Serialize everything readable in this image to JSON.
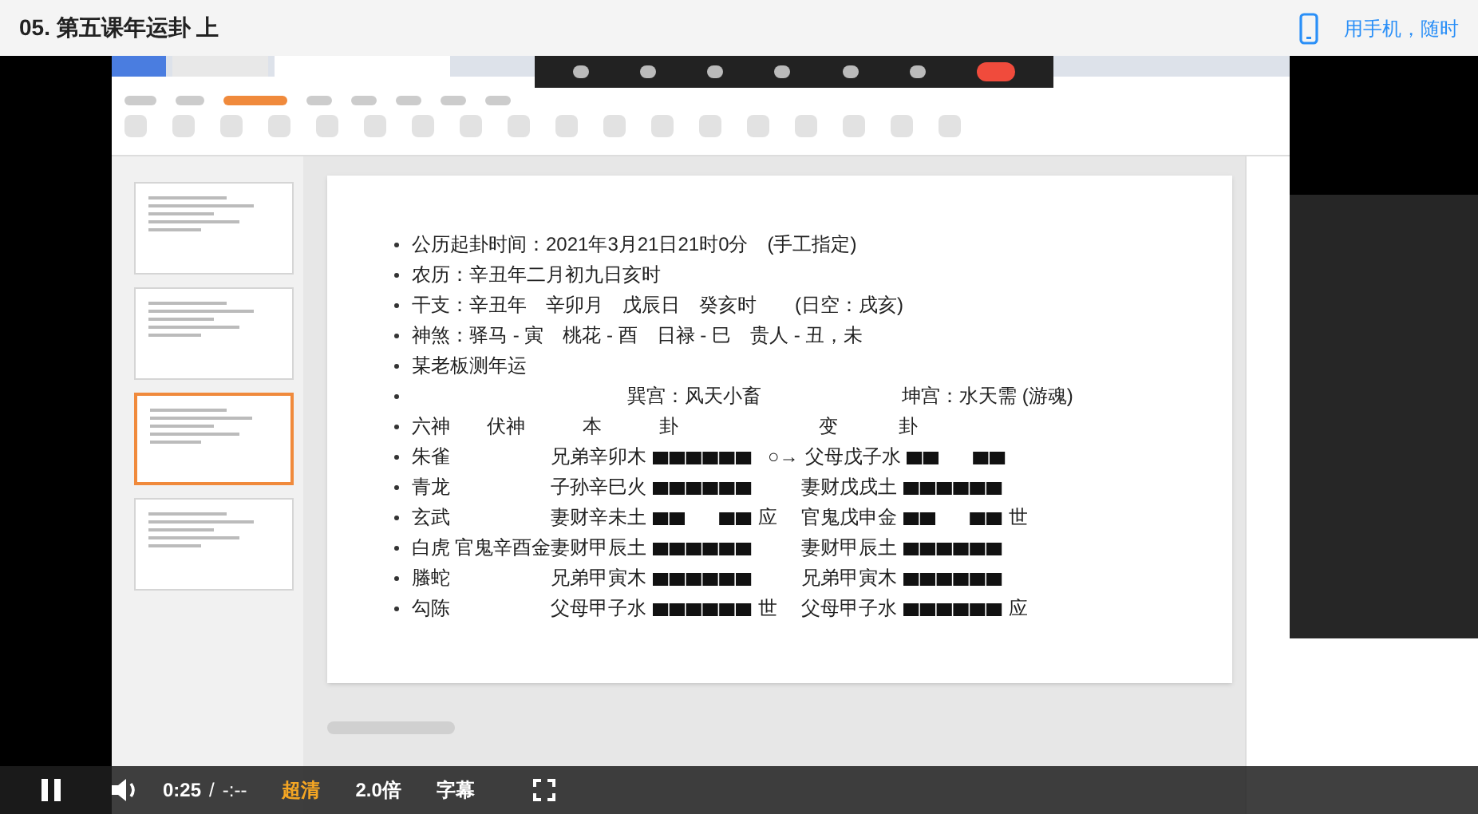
{
  "header": {
    "title": "05. 第五课年运卦 上",
    "phone_link": "用手机，随时"
  },
  "thumbnails": [
    {
      "selected": false
    },
    {
      "selected": false
    },
    {
      "selected": true
    },
    {
      "selected": false
    }
  ],
  "slide": {
    "lines": [
      "公历起卦时间：2021年3月21日21时0分　(手工指定)",
      "农历：辛丑年二月初九日亥时",
      "干支：辛丑年　辛卯月　戊辰日　癸亥时　　(日空：戌亥)",
      "神煞：驿马 - 寅　桃花 - 酉　日禄 - 巳　贵人 - 丑，未",
      "某老板测年运"
    ],
    "palaces": [
      "巽宫：风天小畜",
      "坤宫：水天需 (游魂)"
    ],
    "headings": [
      "六神",
      "伏神",
      "本",
      "卦",
      "变",
      "卦"
    ],
    "rows": [
      {
        "liushen": "朱雀",
        "ben": {
          "text": "兄弟辛卯木",
          "kind": "yang"
        },
        "bian": {
          "text": "父母戊子水",
          "kind": "yin",
          "prefix": "○→"
        }
      },
      {
        "liushen": "青龙",
        "ben": {
          "text": "子孙辛巳火",
          "kind": "yang"
        },
        "bian": {
          "text": "妻财戊戌土",
          "kind": "yang"
        }
      },
      {
        "liushen": "玄武",
        "ben": {
          "text": "妻财辛未土",
          "kind": "yin",
          "mark": "应"
        },
        "bian": {
          "text": "官鬼戊申金",
          "kind": "yin",
          "mark": "世"
        }
      },
      {
        "liushen": "白虎",
        "fushen": "官鬼辛酉金",
        "ben": {
          "text": "妻财甲辰土",
          "kind": "yang"
        },
        "bian": {
          "text": "妻财甲辰土",
          "kind": "yang"
        }
      },
      {
        "liushen": "螣蛇",
        "ben": {
          "text": "兄弟甲寅木",
          "kind": "yang"
        },
        "bian": {
          "text": "兄弟甲寅木",
          "kind": "yang"
        }
      },
      {
        "liushen": "勾陈",
        "ben": {
          "text": "父母甲子水",
          "kind": "yang",
          "mark": "世"
        },
        "bian": {
          "text": "父母甲子水",
          "kind": "yang",
          "mark": "应"
        }
      }
    ]
  },
  "player": {
    "playing": true,
    "time": "0:25",
    "separator": "/",
    "duration": "-:--",
    "quality": "超清",
    "speed": "2.0倍",
    "subtitles": "字幕"
  }
}
